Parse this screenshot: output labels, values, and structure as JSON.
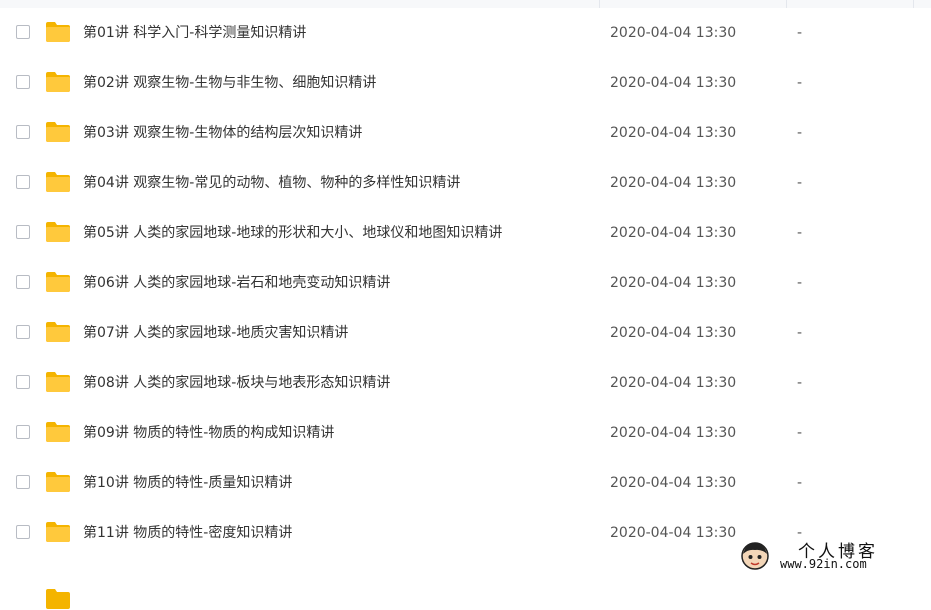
{
  "files": [
    {
      "name": "第01讲 科学入门-科学测量知识精讲",
      "date": "2020-04-04 13:30",
      "size": "-"
    },
    {
      "name": "第02讲 观察生物-生物与非生物、细胞知识精讲",
      "date": "2020-04-04 13:30",
      "size": "-"
    },
    {
      "name": "第03讲 观察生物-生物体的结构层次知识精讲",
      "date": "2020-04-04 13:30",
      "size": "-"
    },
    {
      "name": "第04讲 观察生物-常见的动物、植物、物种的多样性知识精讲",
      "date": "2020-04-04 13:30",
      "size": "-"
    },
    {
      "name": "第05讲 人类的家园地球-地球的形状和大小、地球仪和地图知识精讲",
      "date": "2020-04-04 13:30",
      "size": "-"
    },
    {
      "name": "第06讲 人类的家园地球-岩石和地壳变动知识精讲",
      "date": "2020-04-04 13:30",
      "size": "-"
    },
    {
      "name": "第07讲 人类的家园地球-地质灾害知识精讲",
      "date": "2020-04-04 13:30",
      "size": "-"
    },
    {
      "name": "第08讲 人类的家园地球-板块与地表形态知识精讲",
      "date": "2020-04-04 13:30",
      "size": "-"
    },
    {
      "name": "第09讲 物质的特性-物质的构成知识精讲",
      "date": "2020-04-04 13:30",
      "size": "-"
    },
    {
      "name": "第10讲 物质的特性-质量知识精讲",
      "date": "2020-04-04 13:30",
      "size": "-"
    },
    {
      "name": "第11讲 物质的特性-密度知识精讲",
      "date": "2020-04-04 13:30",
      "size": "-"
    }
  ],
  "icons": {
    "row_checkbox": "checkbox-icon",
    "row_folder": "folder-icon",
    "watermark_avatar": "avatar-icon"
  },
  "colors": {
    "folder": "#FFC93C",
    "folder_tab": "#F4B400",
    "checkbox_border": "#B8BCC4",
    "text": "#333333",
    "meta_text": "#555555"
  },
  "watermark": {
    "title": "个人博客",
    "url": "www.92in.com"
  }
}
